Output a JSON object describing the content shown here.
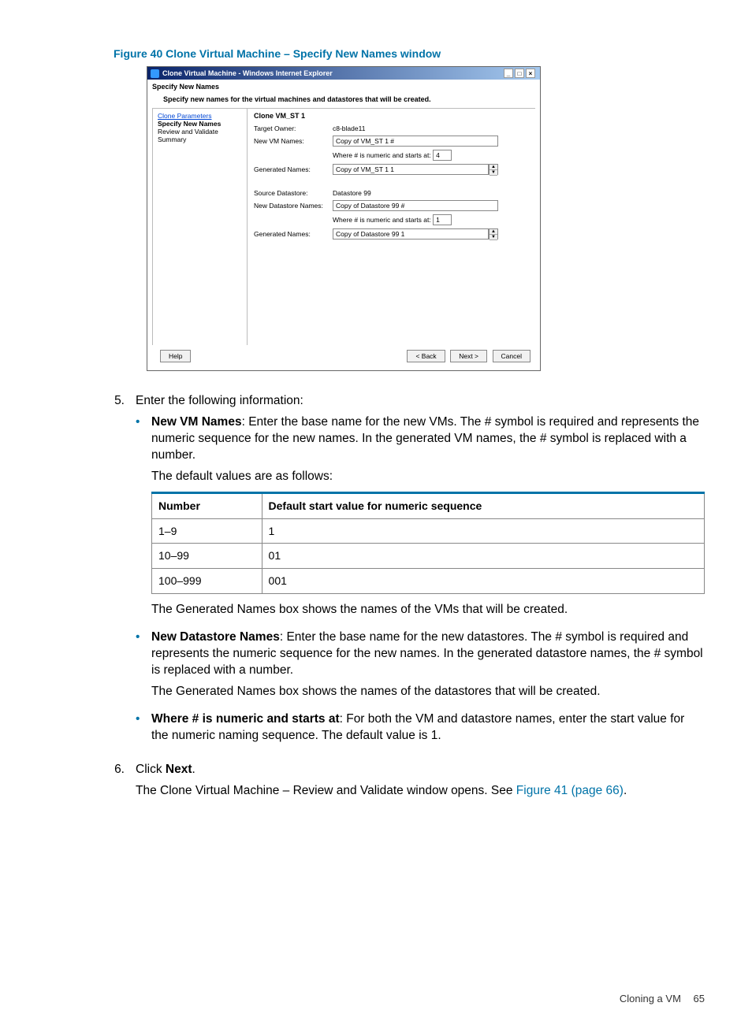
{
  "figure": {
    "caption": "Figure 40 Clone Virtual Machine – Specify New Names window"
  },
  "dialog": {
    "title": "Clone Virtual Machine - Windows Internet Explorer",
    "section_title": "Specify New Names",
    "section_desc": "Specify new names for the virtual machines and datastores that will be created.",
    "nav": {
      "items": [
        {
          "label": "Clone Parameters",
          "type": "link"
        },
        {
          "label": "Specify New Names",
          "type": "active"
        },
        {
          "label": "Review and Validate",
          "type": "plain"
        },
        {
          "label": "Summary",
          "type": "plain"
        }
      ]
    },
    "form": {
      "fieldset_title": "Clone VM_ST 1",
      "target_owner_label": "Target Owner:",
      "target_owner_value": "c8-blade11",
      "new_vm_names_label": "New VM Names:",
      "new_vm_names_value": "Copy of VM_ST 1 #",
      "numeric_prefix": "Where # is numeric and starts at:",
      "vm_numeric_start": "4",
      "generated_names_label": "Generated Names:",
      "vm_generated_value": "Copy of VM_ST 1 1",
      "source_ds_label": "Source Datastore:",
      "source_ds_value": "Datastore 99",
      "new_ds_label": "New Datastore Names:",
      "new_ds_value": "Copy of Datastore 99 #",
      "ds_numeric_start": "1",
      "ds_generated_value": "Copy of Datastore 99 1"
    },
    "footer": {
      "help": "Help",
      "back": "< Back",
      "next": "Next >",
      "cancel": "Cancel"
    }
  },
  "step5": {
    "number": "5.",
    "intro": "Enter the following information:",
    "bullets": [
      {
        "bold": "New VM Names",
        "text": ": Enter the base name for the new VMs. The # symbol is required and represents the numeric sequence for the new names. In the generated VM names, the # symbol is replaced with a number.",
        "p2": "The default values are as follows:",
        "table": {
          "headers": [
            "Number",
            "Default start value for numeric sequence"
          ],
          "rows": [
            [
              "1–9",
              "1"
            ],
            [
              "10–99",
              "01"
            ],
            [
              "100–999",
              "001"
            ]
          ]
        },
        "p3": "The Generated Names box shows the names of the VMs that will be created."
      },
      {
        "bold": "New Datastore Names",
        "text": ": Enter the base name for the new datastores. The # symbol is required and represents the numeric sequence for the new names. In the generated datastore names, the # symbol is replaced with a number.",
        "p2": "The Generated Names box shows the names of the datastores that will be created."
      },
      {
        "bold": "Where # is numeric and starts at",
        "text": ": For both the VM and datastore names, enter the start value for the numeric naming sequence. The default value is 1."
      }
    ]
  },
  "step6": {
    "number": "6.",
    "line1_pre": "Click ",
    "line1_bold": "Next",
    "line1_post": ".",
    "line2_pre": "The Clone Virtual Machine – Review and Validate window opens. See ",
    "line2_link": "Figure 41 (page 66)",
    "line2_post": "."
  },
  "footer": {
    "section": "Cloning a VM",
    "page": "65"
  }
}
